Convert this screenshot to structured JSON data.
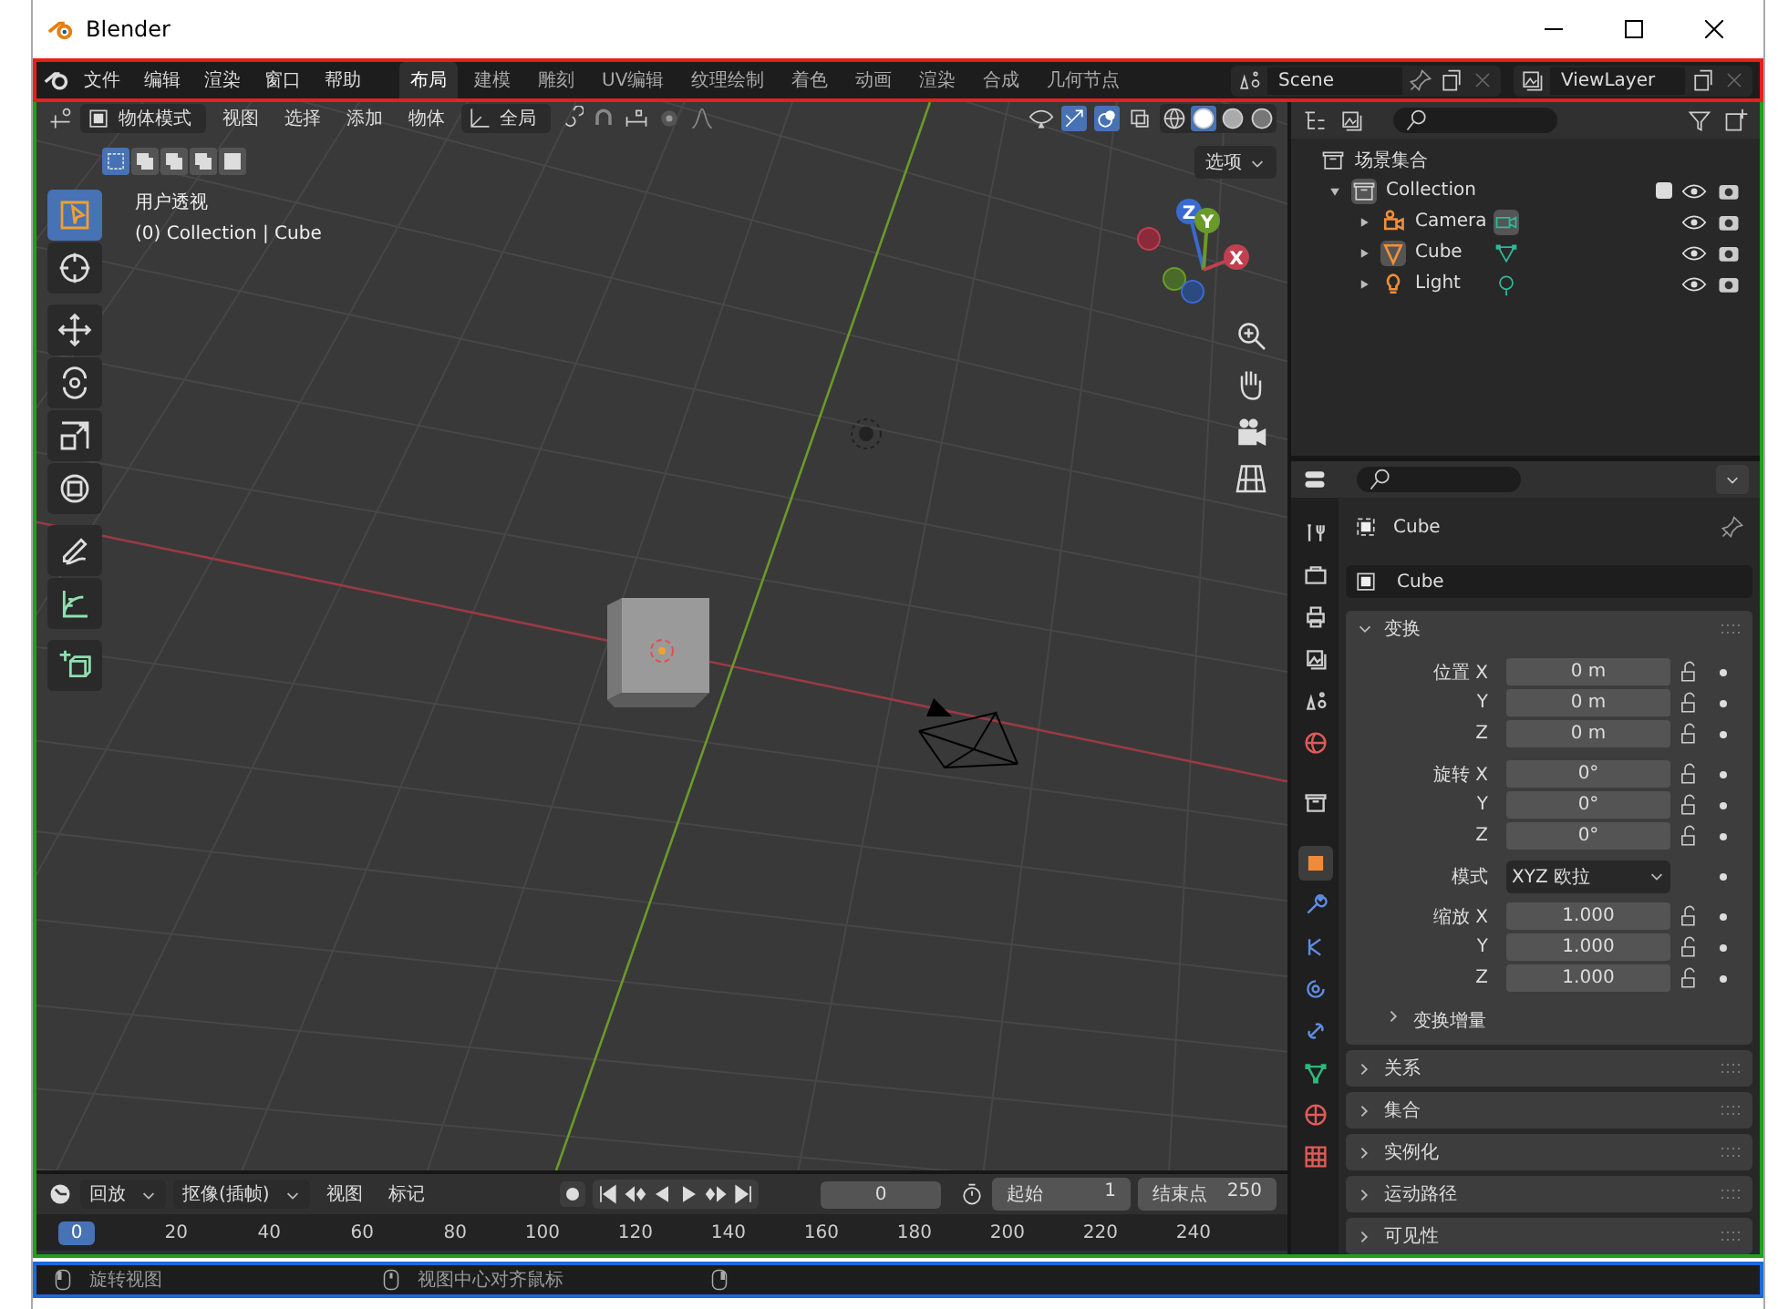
{
  "window": {
    "title": "Blender"
  },
  "top_bar": {
    "menus": [
      "文件",
      "编辑",
      "渲染",
      "窗口",
      "帮助"
    ],
    "workspaces": [
      {
        "label": "布局",
        "selected": true
      },
      {
        "label": "建模",
        "selected": false
      },
      {
        "label": "雕刻",
        "selected": false
      },
      {
        "label": "UV编辑",
        "selected": false
      },
      {
        "label": "纹理绘制",
        "selected": false
      },
      {
        "label": "着色",
        "selected": false
      },
      {
        "label": "动画",
        "selected": false
      },
      {
        "label": "渲染",
        "selected": false
      },
      {
        "label": "合成",
        "selected": false
      },
      {
        "label": "几何节点",
        "selected": false
      }
    ],
    "scene": "Scene",
    "view_layer": "ViewLayer"
  },
  "viewport": {
    "mode": "物体模式",
    "menus": [
      "视图",
      "选择",
      "添加",
      "物体"
    ],
    "orientation": "全局",
    "shading": [
      {
        "kind": "wireframe",
        "selected": false
      },
      {
        "kind": "solid",
        "selected": true
      },
      {
        "kind": "material",
        "selected": false
      },
      {
        "kind": "rendered",
        "selected": false
      }
    ],
    "select_modes": [
      {
        "selected": true
      },
      {
        "selected": false
      },
      {
        "selected": false
      },
      {
        "selected": false
      },
      {
        "selected": false
      }
    ],
    "options": "选项",
    "view_name": "用户透视",
    "object_info": "(0) Collection | Cube",
    "tools": [
      {
        "kind": "select",
        "selected": true
      },
      {
        "kind": "cursor",
        "selected": false
      },
      {
        "kind": "move",
        "selected": false
      },
      {
        "kind": "rotate",
        "selected": false
      },
      {
        "kind": "scale",
        "selected": false
      },
      {
        "kind": "transform",
        "selected": false
      },
      {
        "kind": "annotate",
        "selected": false
      },
      {
        "kind": "measure",
        "selected": false
      },
      {
        "kind": "add-cube",
        "selected": false
      }
    ],
    "gizmo_axes": [
      "Z",
      "Y",
      "X"
    ]
  },
  "outliner": {
    "root": "场景集合",
    "tree": [
      {
        "name": "Collection",
        "kind": "collection",
        "expanded": true,
        "checked": true,
        "children": [
          {
            "name": "Camera",
            "kind": "camera",
            "expanded": false
          },
          {
            "name": "Cube",
            "kind": "mesh",
            "expanded": false
          },
          {
            "name": "Light",
            "kind": "light",
            "expanded": false
          }
        ]
      }
    ]
  },
  "properties": {
    "tabs": [
      {
        "kind": "tool",
        "selected": false
      },
      {
        "kind": "render",
        "selected": false
      },
      {
        "kind": "output",
        "selected": false
      },
      {
        "kind": "view-layer",
        "selected": false
      },
      {
        "kind": "scene",
        "selected": false
      },
      {
        "kind": "world",
        "selected": false
      },
      {
        "kind": "collection",
        "selected": false
      },
      {
        "kind": "object",
        "selected": true
      },
      {
        "kind": "modifier",
        "selected": false
      },
      {
        "kind": "particles",
        "selected": false
      },
      {
        "kind": "physics",
        "selected": false
      },
      {
        "kind": "constraints",
        "selected": false
      },
      {
        "kind": "data",
        "selected": false
      },
      {
        "kind": "material",
        "selected": false
      },
      {
        "kind": "texture",
        "selected": false
      }
    ],
    "title": "Cube",
    "object_name": "Cube",
    "transform": {
      "label": "变换",
      "expanded": true,
      "rows": [
        {
          "label": "位置 X",
          "value": "0 m",
          "kind": "number"
        },
        {
          "label": "Y",
          "value": "0 m",
          "kind": "number"
        },
        {
          "label": "Z",
          "value": "0 m",
          "kind": "number"
        },
        {
          "label": "旋转 X",
          "value": "0°",
          "kind": "number"
        },
        {
          "label": "Y",
          "value": "0°",
          "kind": "number"
        },
        {
          "label": "Z",
          "value": "0°",
          "kind": "number"
        },
        {
          "label": "模式",
          "value": "XYZ 欧拉",
          "kind": "dropdown"
        },
        {
          "label": "缩放 X",
          "value": "1.000",
          "kind": "number"
        },
        {
          "label": "Y",
          "value": "1.000",
          "kind": "number"
        },
        {
          "label": "Z",
          "value": "1.000",
          "kind": "number"
        }
      ],
      "subpanel": {
        "label": "变换增量",
        "expanded": false
      }
    },
    "panels": [
      {
        "label": "关系",
        "expanded": false
      },
      {
        "label": "集合",
        "expanded": false
      },
      {
        "label": "实例化",
        "expanded": false
      },
      {
        "label": "运动路径",
        "expanded": false
      },
      {
        "label": "可见性",
        "expanded": false
      }
    ]
  },
  "timeline": {
    "menus": [
      "回放",
      "抠像(插帧)",
      "视图",
      "标记"
    ],
    "current_frame": "0",
    "start_label": "起始",
    "start": "1",
    "end_label": "结束点",
    "end": "250",
    "playhead": "0",
    "ticks": [
      "20",
      "40",
      "60",
      "80",
      "100",
      "120",
      "140",
      "160",
      "180",
      "200",
      "220",
      "240"
    ]
  },
  "status_bar": [
    {
      "kind": "left-mouse",
      "text": "旋转视图"
    },
    {
      "kind": "middle-mouse",
      "text": "视图中心对齐鼠标"
    },
    {
      "kind": "right-mouse"
    }
  ]
}
